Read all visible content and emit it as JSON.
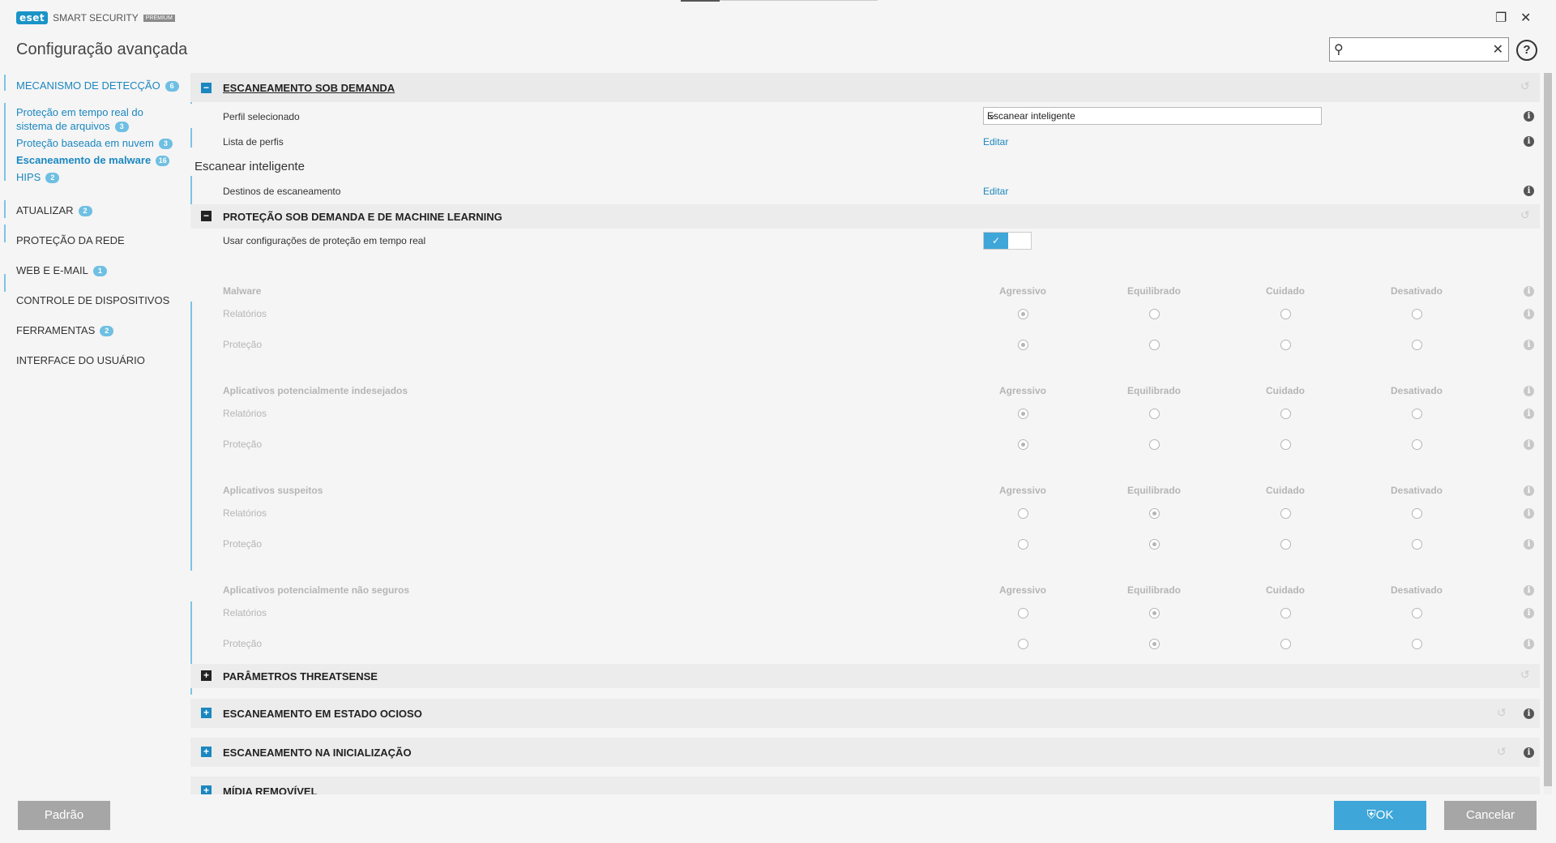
{
  "app": {
    "brand": "eset",
    "product": "SMART SECURITY",
    "edition": "PREMIUM",
    "page_title": "Configuração avançada"
  },
  "search": {
    "placeholder": "",
    "value": ""
  },
  "sidebar": {
    "items": [
      {
        "label": "MECANISMO DE DETECÇÃO",
        "badge": "6"
      },
      {
        "label": "Proteção em tempo real do sistema de arquivos",
        "badge": "3"
      },
      {
        "label": "Proteção baseada em nuvem",
        "badge": "3"
      },
      {
        "label": "Escaneamento de malware",
        "badge": "16"
      },
      {
        "label": "HIPS",
        "badge": "2"
      },
      {
        "label": "ATUALIZAR",
        "badge": "2"
      },
      {
        "label": "PROTEÇÃO DA REDE",
        "badge": ""
      },
      {
        "label": "WEB E E-MAIL",
        "badge": "1"
      },
      {
        "label": "CONTROLE DE DISPOSITIVOS",
        "badge": ""
      },
      {
        "label": "FERRAMENTAS",
        "badge": "2"
      },
      {
        "label": "INTERFACE DO USUÁRIO",
        "badge": ""
      }
    ],
    "sub_line1": "Proteção em tempo real do",
    "sub_line2": "sistema de arquivos"
  },
  "main": {
    "section1": {
      "title": "ESCANEAMENTO SOB DEMANDA",
      "profile_label": "Perfil selecionado",
      "profile_value": "Escanear inteligente",
      "profile_list_label": "Lista de perfis",
      "profile_list_link": "Editar"
    },
    "profile_heading": "Escanear inteligente",
    "targets": {
      "label": "Destinos de escaneamento",
      "link": "Editar"
    },
    "section2": {
      "title": "PROTEÇÃO SOB DEMANDA E DE MACHINE LEARNING",
      "realtime_label": "Usar configurações de proteção em tempo real",
      "realtime_enabled": true
    },
    "columns": [
      "Agressivo",
      "Equilibrado",
      "Cuidado",
      "Desativado"
    ],
    "groups": [
      {
        "title": "Malware",
        "rows": [
          {
            "label": "Relatórios",
            "selected": 0
          },
          {
            "label": "Proteção",
            "selected": 0
          }
        ]
      },
      {
        "title": "Aplicativos potencialmente indesejados",
        "rows": [
          {
            "label": "Relatórios",
            "selected": 0
          },
          {
            "label": "Proteção",
            "selected": 0
          }
        ]
      },
      {
        "title": "Aplicativos suspeitos",
        "rows": [
          {
            "label": "Relatórios",
            "selected": 1
          },
          {
            "label": "Proteção",
            "selected": 1
          }
        ]
      },
      {
        "title": "Aplicativos potencialmente não seguros",
        "rows": [
          {
            "label": "Relatórios",
            "selected": 1
          },
          {
            "label": "Proteção",
            "selected": 1
          }
        ]
      }
    ],
    "collapsed_sections": [
      "PARÂMETROS THREATSENSE",
      "ESCANEAMENTO EM ESTADO OCIOSO",
      "ESCANEAMENTO NA INICIALIZAÇÃO",
      "MÍDIA REMOVÍVEL"
    ]
  },
  "footer": {
    "default_label": "Padrão",
    "ok_label": "OK",
    "cancel_label": "Cancelar"
  },
  "colors": {
    "accent": "#1b87c0",
    "ok_button": "#3ea6d8",
    "neutral_button": "#a6a6a6"
  }
}
